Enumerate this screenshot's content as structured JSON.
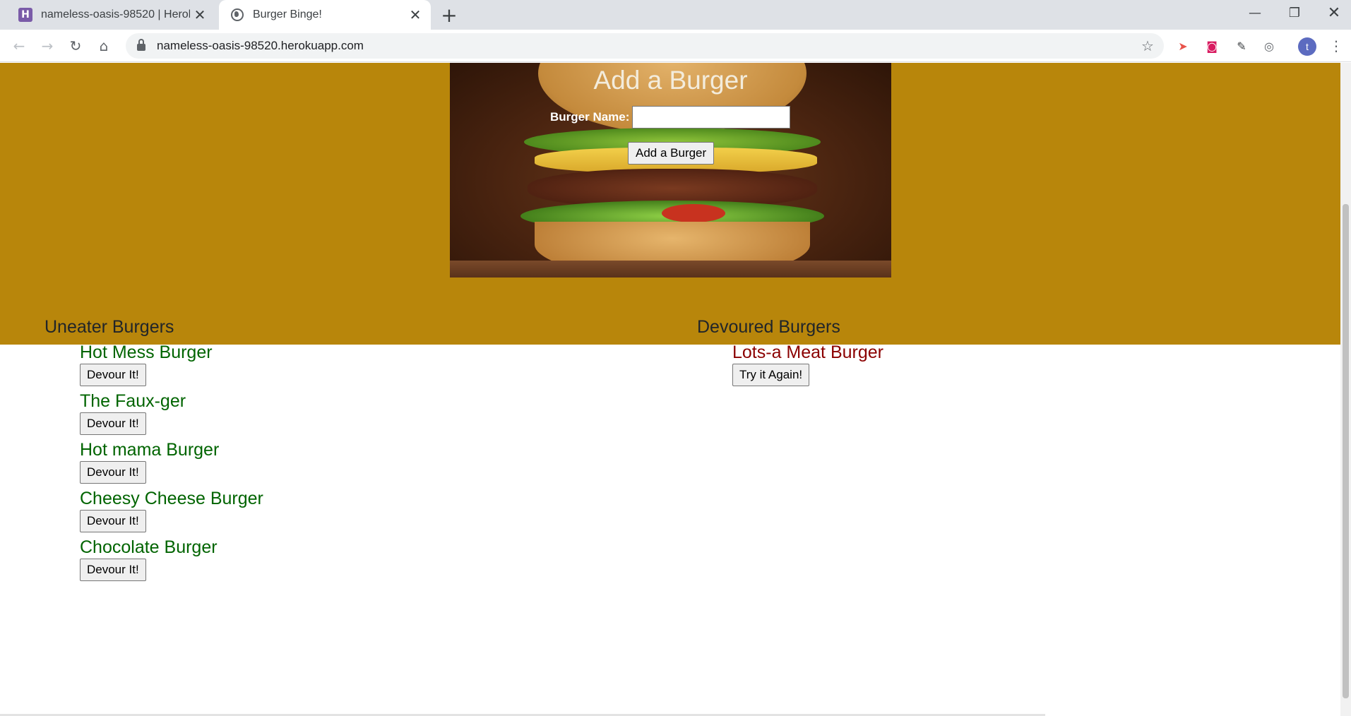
{
  "browser": {
    "tabs": [
      {
        "title": "nameless-oasis-98520 | Heroku",
        "favicon": "heroku-icon",
        "active": false
      },
      {
        "title": "Burger Binge!",
        "favicon": "globe-icon",
        "active": true
      }
    ],
    "url": "nameless-oasis-98520.herokuapp.com",
    "profile_initial": "t"
  },
  "form": {
    "title": "Add a Burger",
    "label": "Burger Name:",
    "input_value": "",
    "button_label": "Add a Burger"
  },
  "colors": {
    "hero_background": "#b8860b",
    "uneaten_text": "#006400",
    "devoured_text": "#8b0000"
  },
  "uneaten": {
    "heading": "Uneater Burgers",
    "items": [
      {
        "name": "Hot Mess Burger",
        "button": "Devour It!"
      },
      {
        "name": "The Faux-ger",
        "button": "Devour It!"
      },
      {
        "name": "Hot mama Burger",
        "button": "Devour It!"
      },
      {
        "name": "Cheesy Cheese Burger",
        "button": "Devour It!"
      },
      {
        "name": "Chocolate Burger",
        "button": "Devour It!"
      }
    ]
  },
  "devoured": {
    "heading": "Devoured Burgers",
    "items": [
      {
        "name": "Lots-a Meat Burger",
        "button": "Try it Again!"
      }
    ]
  }
}
